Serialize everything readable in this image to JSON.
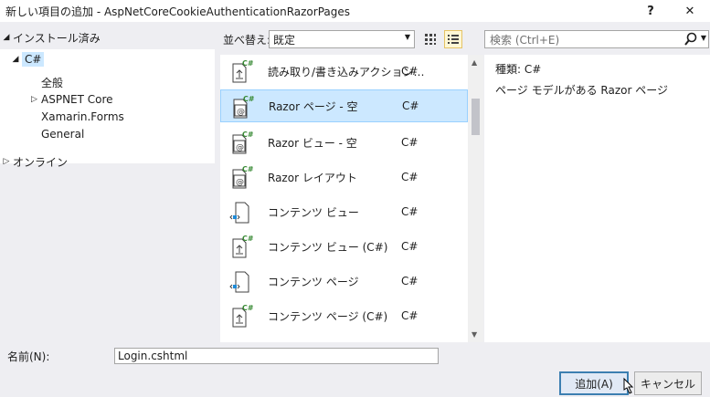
{
  "window": {
    "title": "新しい項目の追加 - AspNetCoreCookieAuthenticationRazorPages",
    "help_label": "?",
    "close_label": "✕"
  },
  "tree": {
    "installed_label": "インストール済み",
    "csharp_label": "C#",
    "children": [
      {
        "label": "全般"
      },
      {
        "label": "ASPNET Core",
        "expandable": true
      },
      {
        "label": "Xamarin.Forms"
      },
      {
        "label": "General"
      }
    ],
    "online_label": "オンライン"
  },
  "toolbar": {
    "sort_label": "並べ替え:",
    "sort_value": "既定",
    "view_grid_icon": "grid-view-icon",
    "view_list_icon": "list-view-icon"
  },
  "search": {
    "placeholder": "検索 (Ctrl+E)"
  },
  "templates": [
    {
      "name": "読み取り/書き込みアクション…",
      "lang": "C#",
      "icon": "cs-action-icon"
    },
    {
      "name": "Razor ページ - 空",
      "lang": "C#",
      "icon": "razor-page-icon",
      "selected": true
    },
    {
      "name": "Razor ビュー - 空",
      "lang": "C#",
      "icon": "razor-view-icon"
    },
    {
      "name": "Razor レイアウト",
      "lang": "C#",
      "icon": "razor-layout-icon"
    },
    {
      "name": "コンテンツ ビュー",
      "lang": "C#",
      "icon": "content-view-icon"
    },
    {
      "name": "コンテンツ ビュー (C#)",
      "lang": "C#",
      "icon": "cs-content-view-icon"
    },
    {
      "name": "コンテンツ ページ",
      "lang": "C#",
      "icon": "content-page-icon"
    },
    {
      "name": "コンテンツ ページ (C#)",
      "lang": "C#",
      "icon": "cs-content-page-icon"
    }
  ],
  "details": {
    "type_label": "種類:",
    "type_value": "C#",
    "description": "ページ モデルがある Razor ページ"
  },
  "footer": {
    "name_label": "名前(N):",
    "name_value": "Login.cshtml",
    "add_label": "追加(A)",
    "cancel_label": "キャンセル"
  }
}
